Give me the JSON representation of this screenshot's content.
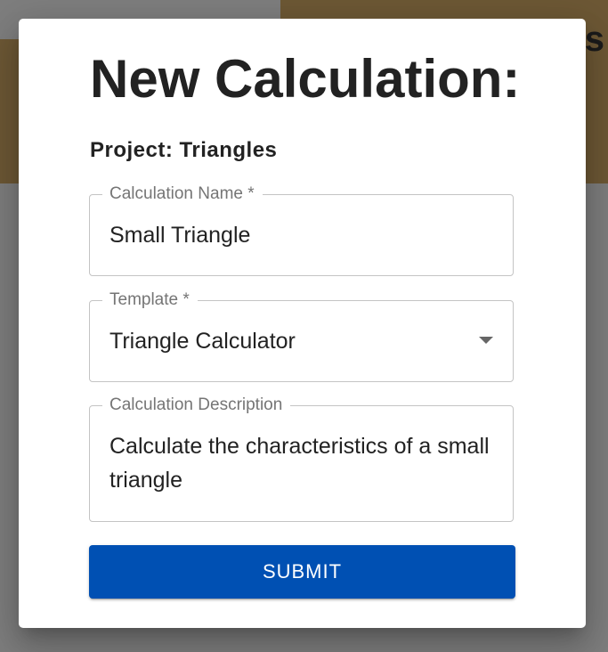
{
  "background": {
    "heading_fragment": "s"
  },
  "modal": {
    "title": "New Calculation:",
    "project_label": "Project: Triangles",
    "fields": {
      "name": {
        "label": "Calculation Name *",
        "value": "Small Triangle"
      },
      "template": {
        "label": "Template *",
        "value": "Triangle Calculator"
      },
      "description": {
        "label": "Calculation Description",
        "value": "Calculate the characteristics of a small triangle"
      }
    },
    "submit_label": "SUBMIT"
  },
  "colors": {
    "primary": "#0050b3",
    "backdrop": "#7e7e7e",
    "background_band": "#6d5835",
    "field_border": "#c4c4c4"
  }
}
